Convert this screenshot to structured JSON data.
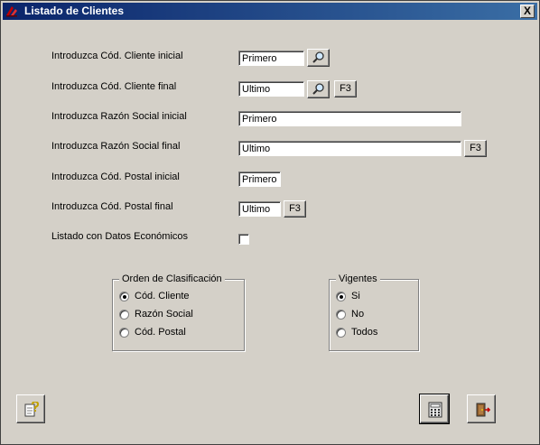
{
  "window": {
    "title": "Listado de Clientes",
    "close_label": "X"
  },
  "fields": {
    "cliente_inicial": {
      "label": "Introduzca Cód. Cliente inicial",
      "value": "Primero"
    },
    "cliente_final": {
      "label": "Introduzca Cód. Cliente final",
      "value": "Ultimo",
      "f3": "F3"
    },
    "razon_inicial": {
      "label": "Introduzca Razón Social inicial",
      "value": "Primero"
    },
    "razon_final": {
      "label": "Introduzca Razón Social final",
      "value": "Ultimo",
      "f3": "F3"
    },
    "postal_inicial": {
      "label": "Introduzca Cód. Postal inicial",
      "value": "Primero"
    },
    "postal_final": {
      "label": "Introduzca Cód. Postal final",
      "value": "Ultimo",
      "f3": "F3"
    },
    "economicos": {
      "label": "Listado con Datos Económicos",
      "checked": false
    }
  },
  "orden": {
    "title": "Orden de Clasificación",
    "options": [
      "Cód. Cliente",
      "Razón Social",
      "Cód. Postal"
    ],
    "selected": "Cód. Cliente"
  },
  "vigentes": {
    "title": "Vigentes",
    "options": [
      "Si",
      "No",
      "Todos"
    ],
    "selected": "Si"
  },
  "icons": {
    "help": "help-icon",
    "calculator": "calculator-icon",
    "exit": "exit-door-icon",
    "search": "search-icon"
  }
}
